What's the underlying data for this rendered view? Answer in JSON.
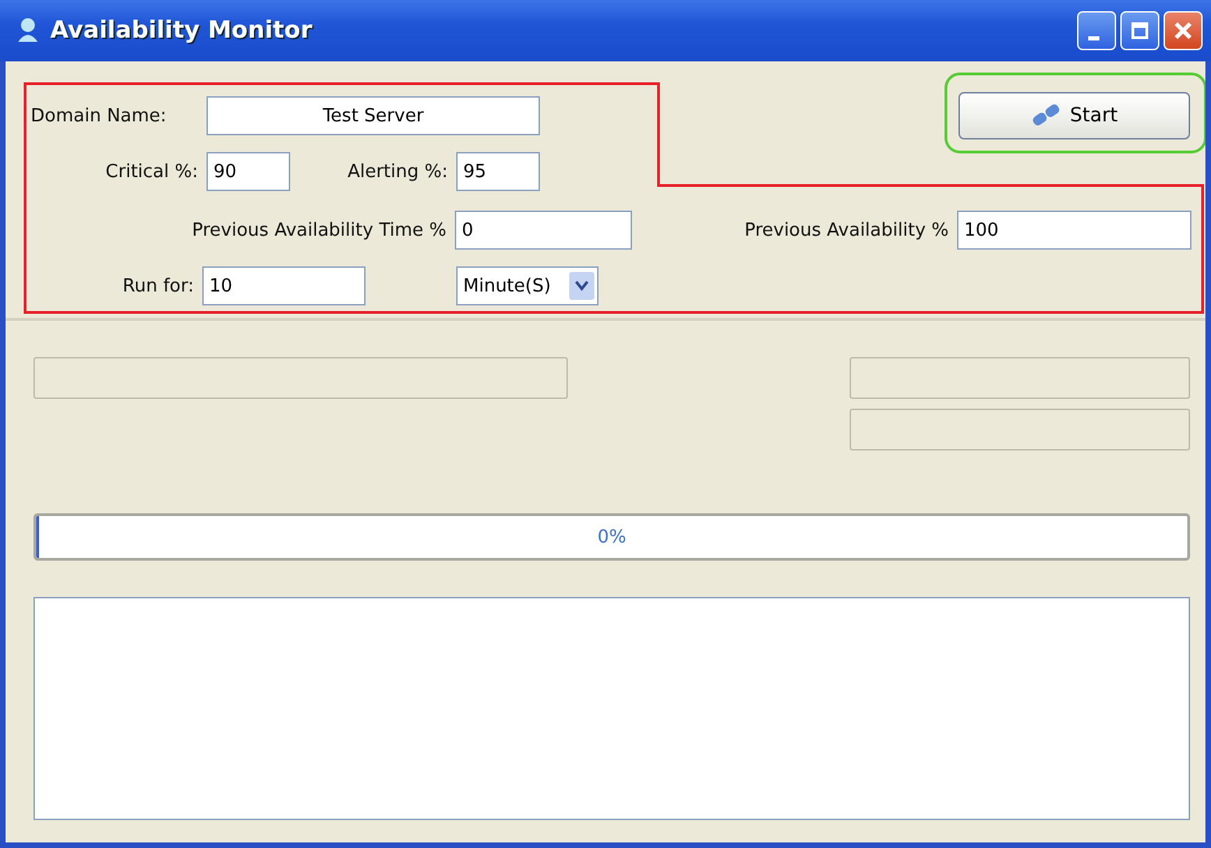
{
  "window": {
    "title": "Availability Monitor"
  },
  "domain_name": {
    "label": "Domain Name:",
    "value": "Test Server"
  },
  "start_button": {
    "label": "Start"
  },
  "critical": {
    "label": "Critical %:",
    "value": "90"
  },
  "alerting": {
    "label": "Alerting %:",
    "value": "95"
  },
  "previous_availability_time": {
    "label": "Previous Availability Time %",
    "value": "0"
  },
  "previous_availability": {
    "label": "Previous Availability %",
    "value": "100"
  },
  "run_for": {
    "label": "Run for:",
    "value": "10",
    "unit": "Minute(S)"
  },
  "progress": {
    "level": 0,
    "label": "0%"
  }
}
